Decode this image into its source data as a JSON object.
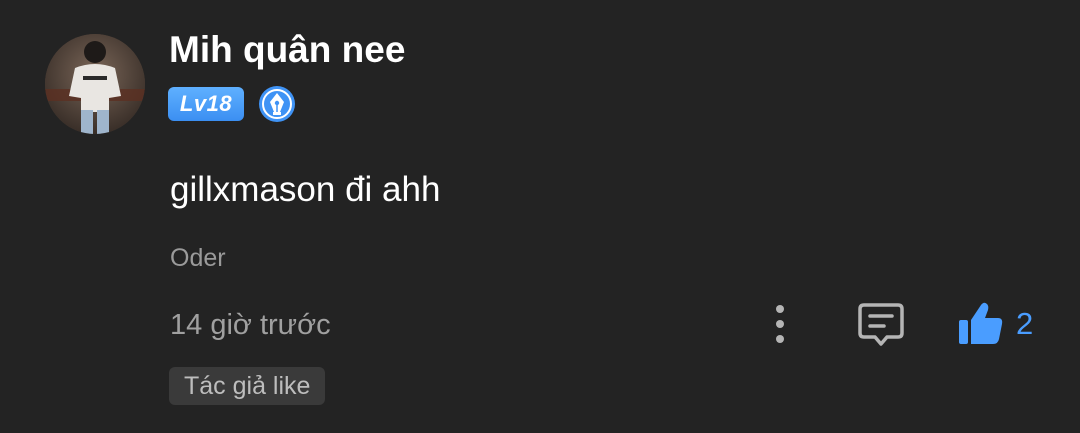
{
  "user": {
    "name": "Mih quân nee",
    "level": "Lv18"
  },
  "comment": {
    "text": "gillxmason đi ahh",
    "tag": "Oder",
    "timestamp": "14 giờ trước"
  },
  "actions": {
    "more_icon": "more-vertical-icon",
    "reply_icon": "comment-icon",
    "like_icon": "thumbs-up-icon",
    "like_count": "2"
  },
  "author_like_label": "Tác giả like",
  "colors": {
    "background": "#232323",
    "accent": "#4a9dff",
    "level_badge": "#4a9dff",
    "chip_background": "#3a3a3a"
  }
}
